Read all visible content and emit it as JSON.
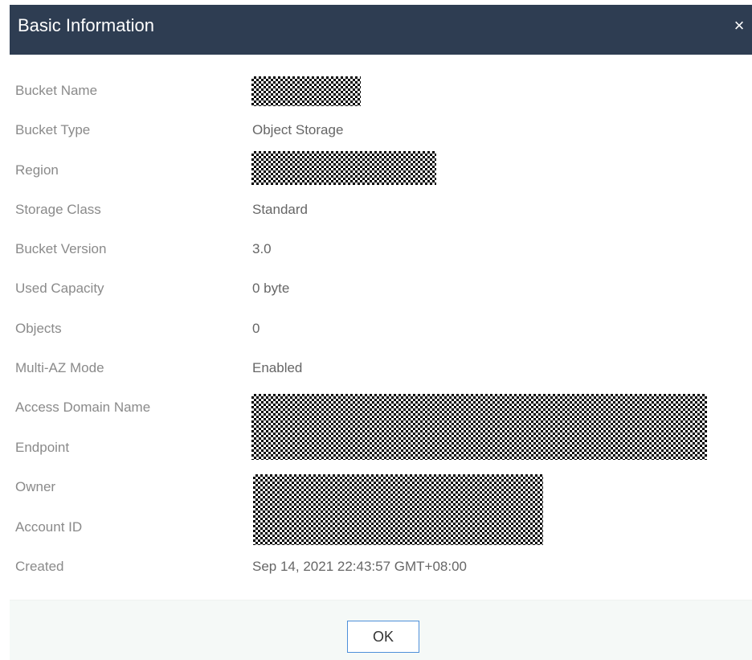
{
  "dialog": {
    "title": "Basic Information",
    "close_icon": "close-icon",
    "close_glyph": "×"
  },
  "fields": {
    "bucket_name": {
      "label": "Bucket Name",
      "value": ""
    },
    "bucket_type": {
      "label": "Bucket Type",
      "value": "Object Storage"
    },
    "region": {
      "label": "Region",
      "value": ""
    },
    "storage_class": {
      "label": "Storage Class",
      "value": "Standard"
    },
    "bucket_version": {
      "label": "Bucket Version",
      "value": "3.0"
    },
    "used_capacity": {
      "label": "Used Capacity",
      "value": "0 byte"
    },
    "objects": {
      "label": "Objects",
      "value": "0"
    },
    "multi_az_mode": {
      "label": "Multi-AZ Mode",
      "value": "Enabled"
    },
    "access_domain_name": {
      "label": "Access Domain Name",
      "value": ""
    },
    "endpoint": {
      "label": "Endpoint",
      "value": ""
    },
    "owner": {
      "label": "Owner",
      "value": ""
    },
    "account_id": {
      "label": "Account ID",
      "value": ""
    },
    "created": {
      "label": "Created",
      "value": "Sep 14, 2021 22:43:57 GMT+08:00"
    }
  },
  "footer": {
    "ok_label": "OK"
  },
  "colors": {
    "header_bg": "#2e3d52",
    "label_text": "#8a8a8a",
    "value_text": "#666666",
    "footer_bg": "#f5f9f7",
    "ok_border": "#4d8fd9"
  }
}
